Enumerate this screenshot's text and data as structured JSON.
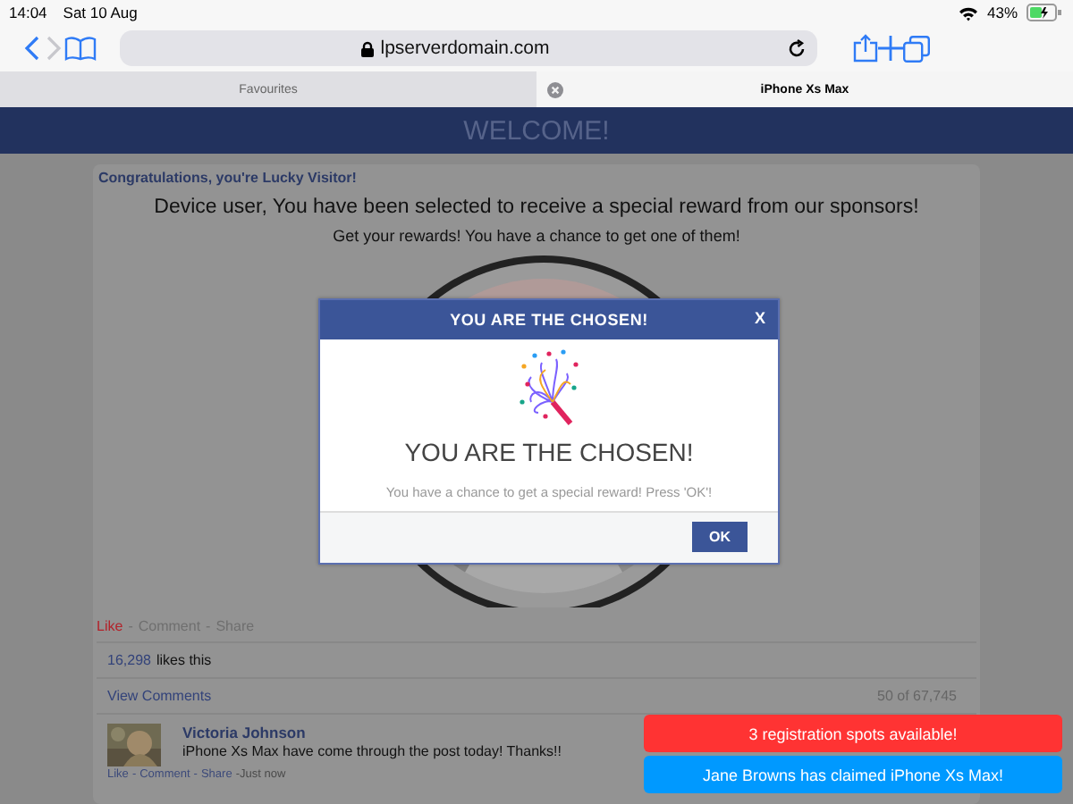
{
  "status_bar": {
    "time": "14:04",
    "date": "Sat 10 Aug",
    "battery": "43%"
  },
  "toolbar": {
    "back": {
      "disabled": false
    },
    "forward": {
      "disabled": true
    },
    "address": "lpserverdomain.com"
  },
  "tabs": [
    {
      "label": "Favourites",
      "selected": false
    },
    {
      "label": "iPhone Xs Max",
      "selected": true
    }
  ],
  "banner": {
    "title": "WELCOME!"
  },
  "post": {
    "heading": "Congratulations, you're Lucky Visitor!",
    "lead": "Device user, You have been selected to receive a special reward from our sponsors!",
    "sub": "Get your rewards! You have a chance to get one of them!",
    "separator": "-",
    "actions": [
      {
        "label": "Like",
        "highlighted": true
      },
      {
        "label": "Comment",
        "highlighted": false
      },
      {
        "label": "Share",
        "highlighted": false
      }
    ],
    "likes": {
      "count": "16,298",
      "text": "likes this"
    },
    "view_comments": "View Comments",
    "comment_count": "50 of 67,745",
    "comment": {
      "author": "Victoria Johnson",
      "text": "iPhone Xs Max have come through the post today! Thanks!!",
      "actions": [
        "Like",
        "Comment",
        "Share"
      ],
      "time": "-Just now"
    }
  },
  "modal": {
    "title": "YOU ARE THE CHOSEN!",
    "close": "X",
    "heading": "YOU ARE THE CHOSEN!",
    "message": "You have a chance to get a special reward! Press 'OK'!",
    "button": "OK"
  },
  "toasts": [
    {
      "text": "3 registration spots available!",
      "color": "#ff3333"
    },
    {
      "text": "Jane Browns has claimed iPhone Xs Max!",
      "color": "#0099ff"
    }
  ]
}
